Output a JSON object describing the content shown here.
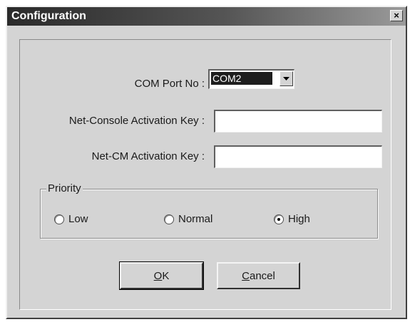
{
  "window": {
    "title": "Configuration",
    "close_glyph": "×"
  },
  "fields": {
    "com_port": {
      "label": "COM Port No :",
      "value": "COM2"
    },
    "net_console_key": {
      "label": "Net-Console Activation Key :",
      "value": ""
    },
    "net_cm_key": {
      "label": "Net-CM Activation Key :",
      "value": ""
    }
  },
  "priority": {
    "legend": "Priority",
    "options": [
      {
        "label": "Low",
        "selected": false
      },
      {
        "label": "Normal",
        "selected": false
      },
      {
        "label": "High",
        "selected": true
      }
    ]
  },
  "buttons": {
    "ok": {
      "mnemonic": "O",
      "rest": "K"
    },
    "cancel": {
      "mnemonic": "C",
      "rest": "ancel"
    }
  },
  "icons": {
    "close": "close-icon",
    "dropdown": "chevron-down-icon"
  }
}
